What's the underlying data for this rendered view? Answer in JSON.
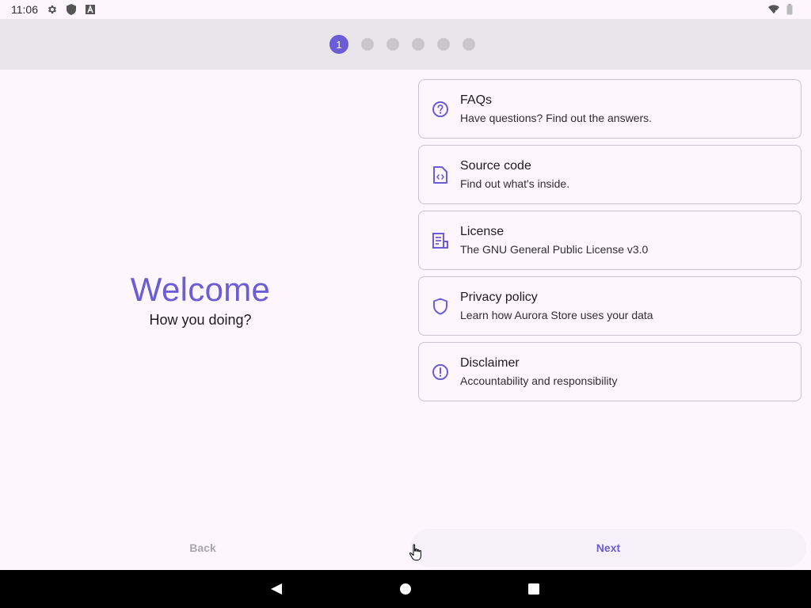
{
  "status_bar": {
    "time": "11:06",
    "icons": [
      "settings-icon",
      "shield-icon",
      "font-icon"
    ],
    "right_icons": [
      "wifi-icon",
      "battery-icon"
    ]
  },
  "stepper": {
    "active_step": "1",
    "total_steps": 6
  },
  "welcome": {
    "title": "Welcome",
    "subtitle": "How you doing?"
  },
  "links": [
    {
      "icon": "help-circle-icon",
      "title": "FAQs",
      "subtitle": "Have questions? Find out the answers."
    },
    {
      "icon": "source-code-icon",
      "title": "Source code",
      "subtitle": "Find out what's inside."
    },
    {
      "icon": "license-icon",
      "title": "License",
      "subtitle": "The GNU General Public License v3.0"
    },
    {
      "icon": "shield-outline-icon",
      "title": "Privacy policy",
      "subtitle": "Learn how Aurora Store uses your data"
    },
    {
      "icon": "alert-circle-icon",
      "title": "Disclaimer",
      "subtitle": "Accountability and responsibility"
    }
  ],
  "buttons": {
    "back": "Back",
    "next": "Next"
  },
  "colors": {
    "accent": "#6b5cd7",
    "background": "#fdf7fd",
    "header": "#e8e6ea"
  }
}
